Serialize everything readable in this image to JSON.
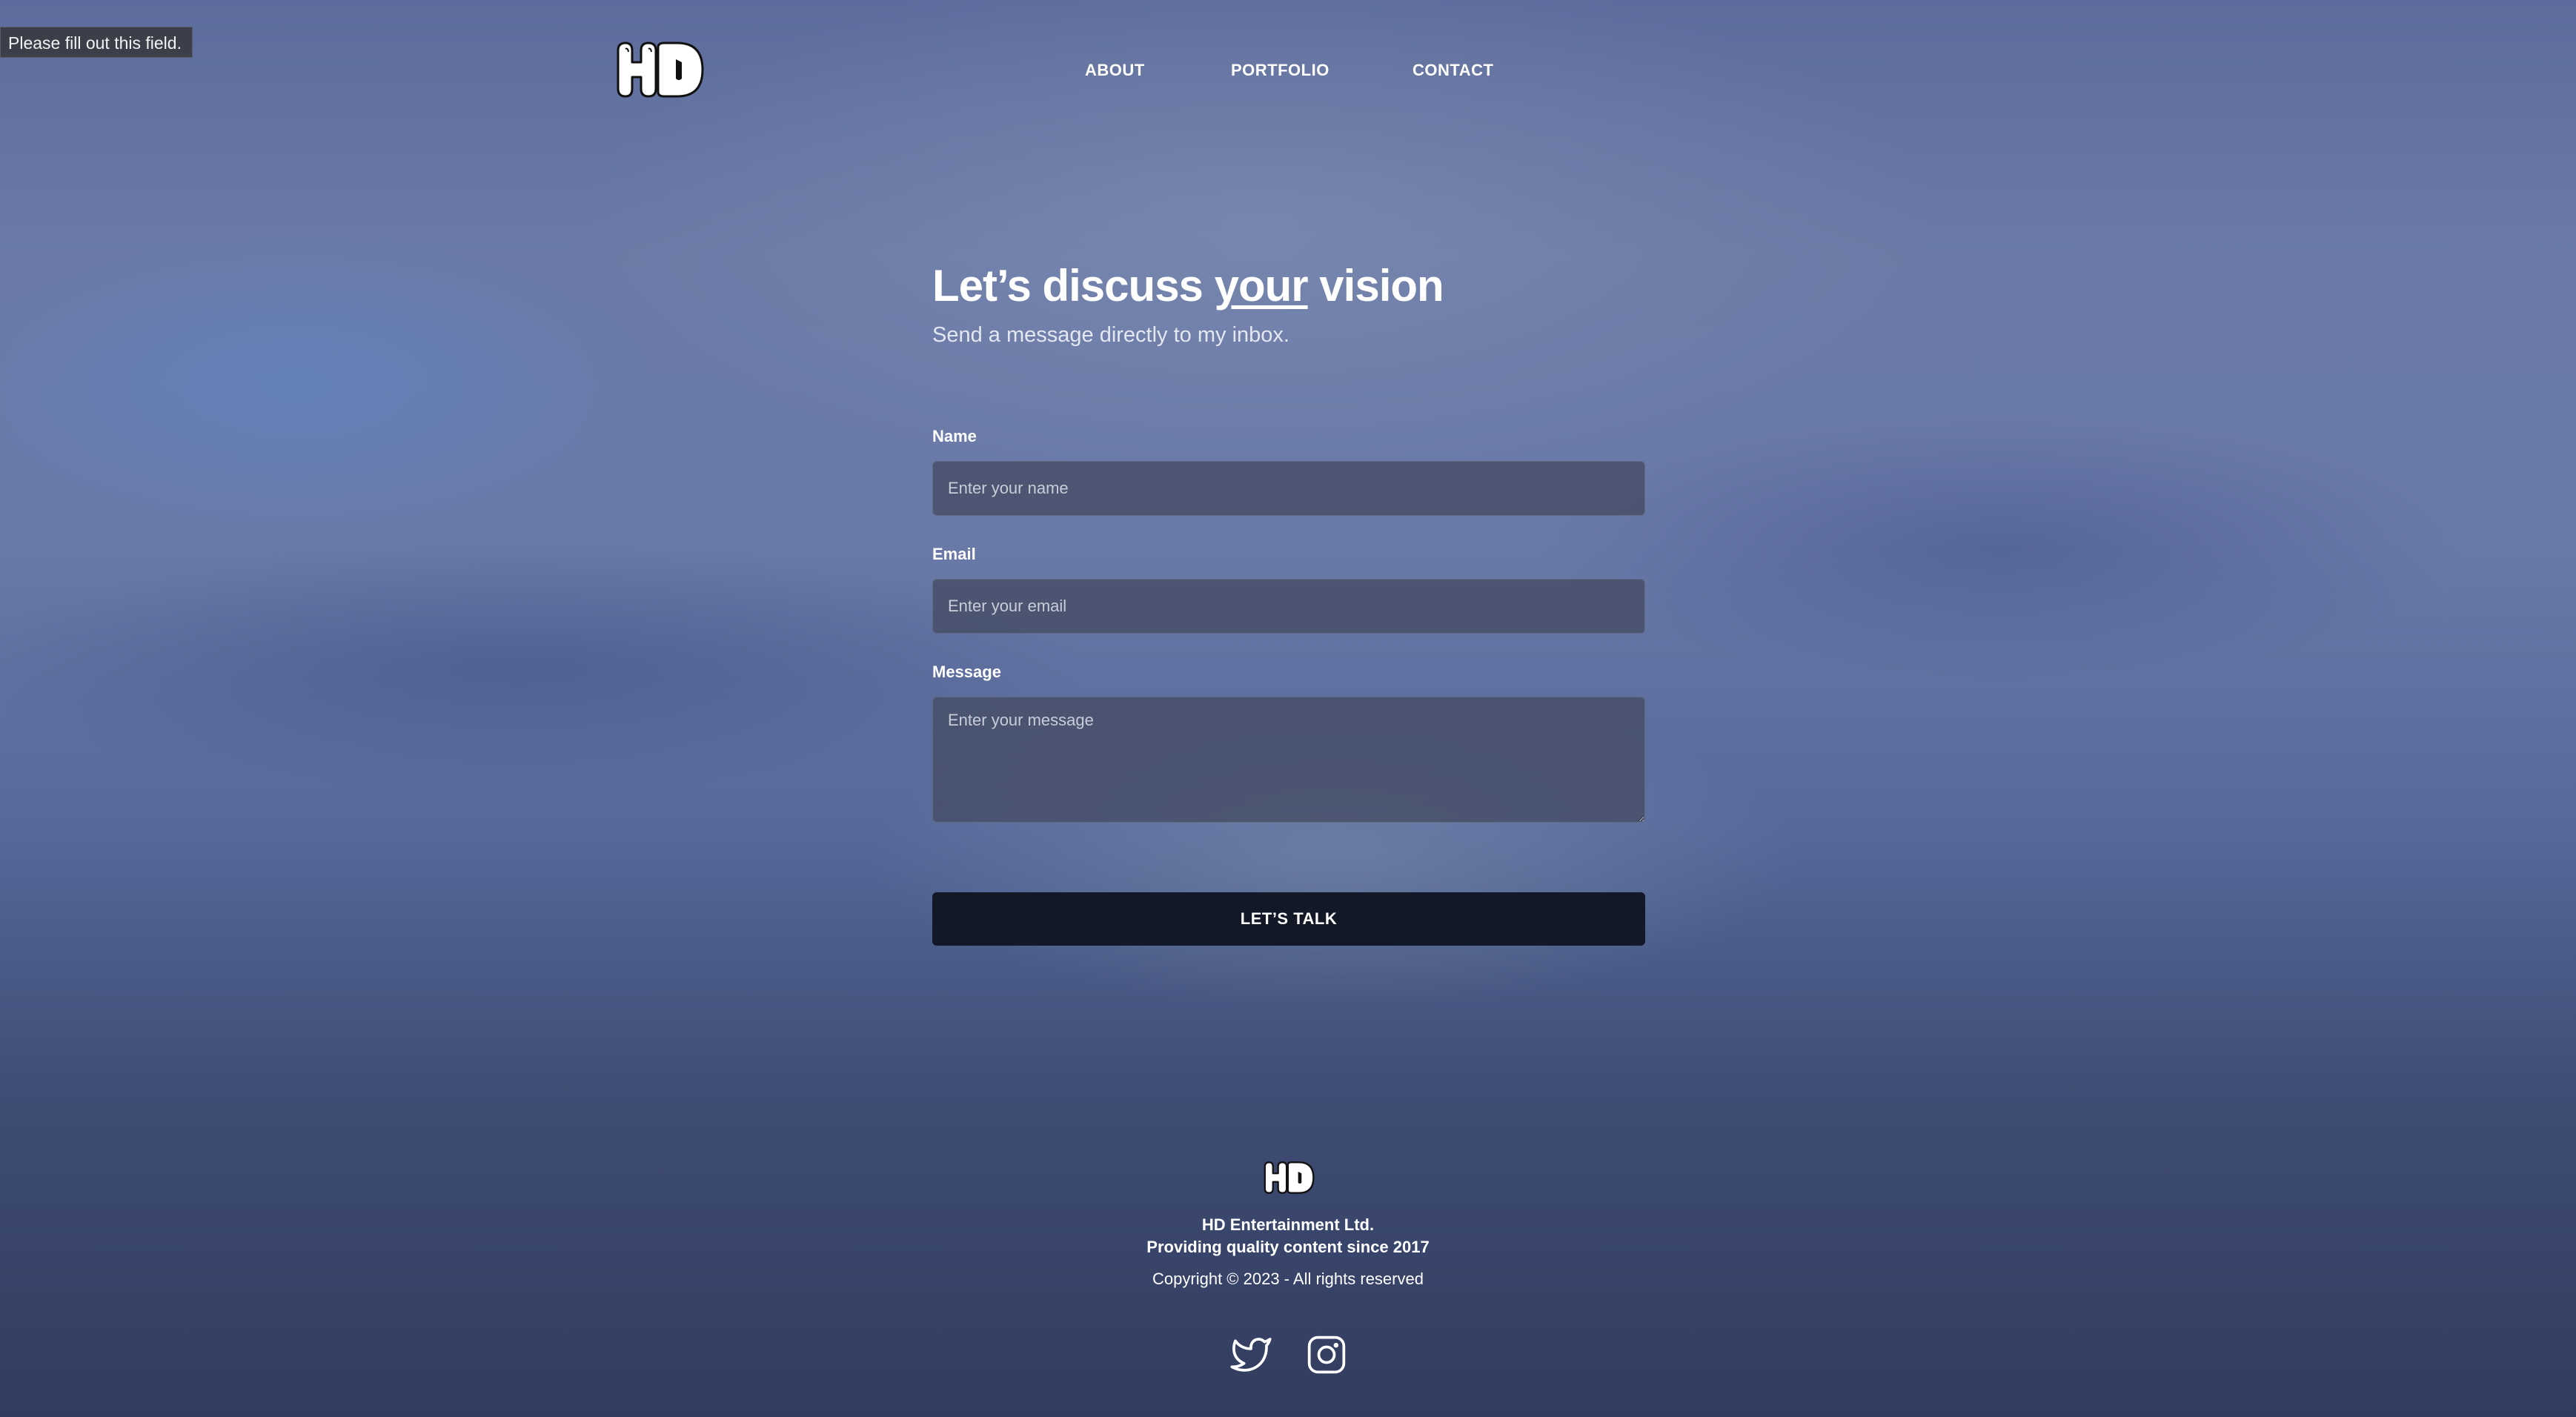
{
  "tooltip": {
    "text": "Please fill out this field."
  },
  "header": {
    "logo_icon": "hd-bubble-logo-icon",
    "nav": [
      {
        "label": "ABOUT"
      },
      {
        "label": "PORTFOLIO"
      },
      {
        "label": "CONTACT"
      }
    ]
  },
  "hero": {
    "title_start": "Let’s discuss ",
    "title_emphasis": "your",
    "title_end": " vision",
    "subtitle": "Send a message directly to my inbox."
  },
  "form": {
    "name": {
      "label": "Name",
      "placeholder": "Enter your name",
      "value": ""
    },
    "email": {
      "label": "Email",
      "placeholder": "Enter your email",
      "value": ""
    },
    "message": {
      "label": "Message",
      "placeholder": "Enter your message",
      "value": ""
    },
    "submit_label": "LET’S TALK"
  },
  "footer": {
    "logo_icon": "hd-bubble-logo-icon",
    "company": "HD Entertainment Ltd.",
    "tagline": "Providing quality content since 2017",
    "copyright": "Copyright © 2023 - All rights reserved",
    "social": [
      {
        "icon": "twitter-icon"
      },
      {
        "icon": "instagram-icon"
      }
    ]
  },
  "colors": {
    "button_bg": "#131826",
    "field_bg": "#464e66",
    "text": "#ffffff"
  }
}
